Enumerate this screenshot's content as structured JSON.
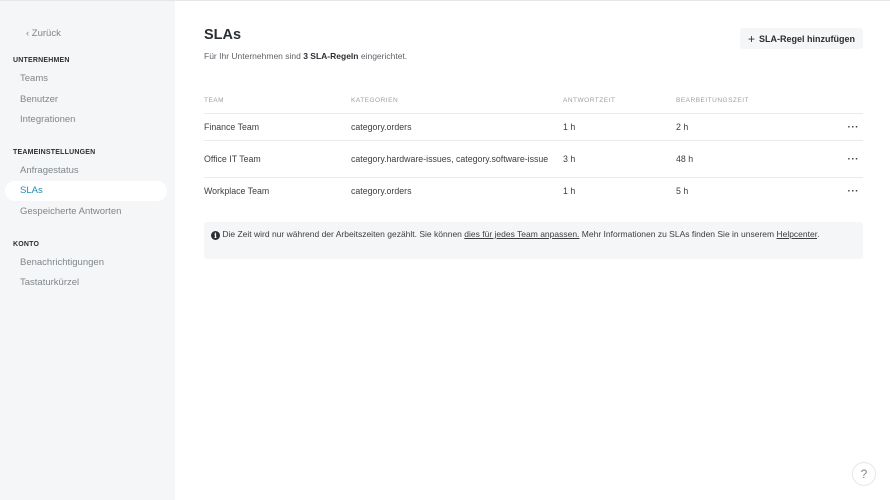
{
  "sidebar": {
    "back_label": "‹ Zurück",
    "sections": [
      {
        "title": "UNTERNEHMEN",
        "items": [
          "Teams",
          "Benutzer",
          "Integrationen"
        ]
      },
      {
        "title": "TEAMEINSTELLUNGEN",
        "items": [
          "Anfragestatus",
          "SLAs",
          "Gespeicherte Antworten"
        ]
      },
      {
        "title": "KONTO",
        "items": [
          "Benachrichtigungen",
          "Tastaturkürzel"
        ]
      }
    ],
    "active_item": "SLAs"
  },
  "header": {
    "title": "SLAs",
    "subtitle_prefix": "Für Ihr Unternehmen sind ",
    "subtitle_bold": "3 SLA-Regeln",
    "subtitle_suffix": " eingerichtet.",
    "add_button_icon": "+",
    "add_button_label": "SLA-Regel hinzufügen"
  },
  "table": {
    "columns": [
      "TEAM",
      "KATEGORIEN",
      "ANTWORTZEIT",
      "BEARBEITUNGSZEIT"
    ],
    "rows": [
      {
        "team": "Finance Team",
        "categories": "category.orders",
        "response": "1 h",
        "resolution": "2 h",
        "more": "···"
      },
      {
        "team": "Office IT Team",
        "categories": "category.hardware-issues, category.software-issue",
        "response": "3 h",
        "resolution": "48 h",
        "more": "···"
      },
      {
        "team": "Workplace Team",
        "categories": "category.orders",
        "response": "1 h",
        "resolution": "5 h",
        "more": "···"
      }
    ]
  },
  "info": {
    "icon": "i",
    "text_before": " Die Zeit wird nur während der Arbeitszeiten gezählt. Sie können ",
    "link1": "dies für jedes Team anpassen.",
    "text_middle": " Mehr Informationen zu SLAs finden Sie in unserem ",
    "link2": "Helpcenter",
    "text_after": "."
  },
  "help_button": "?"
}
